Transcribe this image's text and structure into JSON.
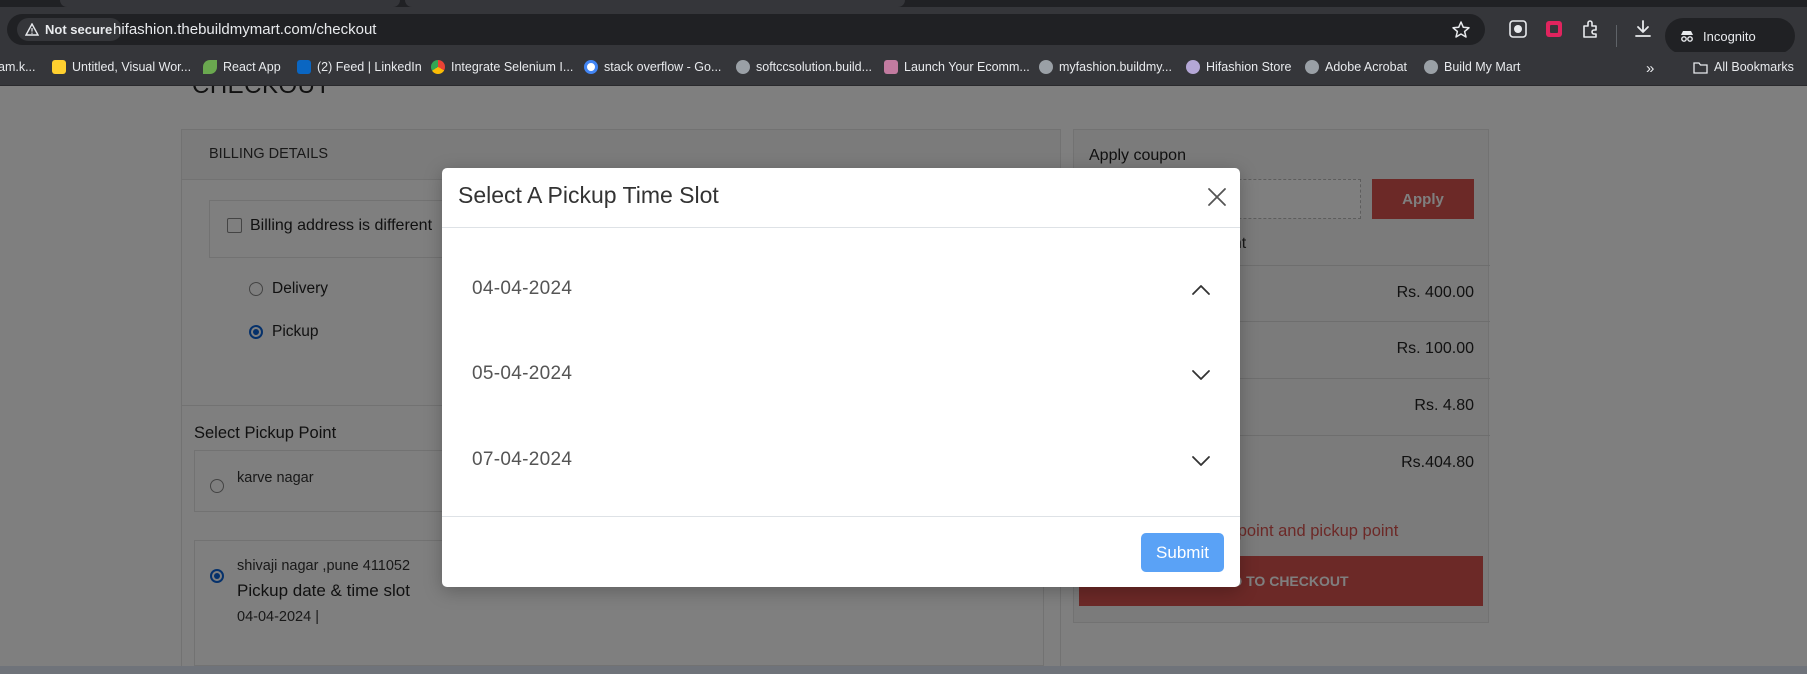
{
  "browser": {
    "not_secure_label": "Not secure",
    "url": "hifashion.thebuildmymart.com/checkout",
    "incognito_label": "Incognito",
    "all_bookmarks_label": "All Bookmarks",
    "bookmarks": [
      {
        "label": "am.k...",
        "icon": "favicon-partial"
      },
      {
        "label": "Untitled, Visual Wor...",
        "icon": "miro-icon"
      },
      {
        "label": "React App",
        "icon": "leaf-icon"
      },
      {
        "label": "(2) Feed | LinkedIn",
        "icon": "linkedin-icon"
      },
      {
        "label": "Integrate Selenium I...",
        "icon": "chrome-icon"
      },
      {
        "label": "stack overflow - Go...",
        "icon": "google-icon"
      },
      {
        "label": "softccsolution.build...",
        "icon": "globe-icon"
      },
      {
        "label": "Launch Your Ecomm...",
        "icon": "store-icon"
      },
      {
        "label": "myfashion.buildmy...",
        "icon": "globe-icon"
      },
      {
        "label": "Hifashion Store",
        "icon": "hifashion-icon"
      },
      {
        "label": "Adobe Acrobat",
        "icon": "globe-icon"
      },
      {
        "label": "Build My Mart",
        "icon": "globe-icon"
      }
    ]
  },
  "page": {
    "title": "CHECKOUT",
    "billing": {
      "header": "BILLING DETAILS",
      "different_address_label": "Billing address is different",
      "delivery_label": "Delivery",
      "pickup_label": "Pickup",
      "select_pickup_point_label": "Select Pickup Point",
      "pickup_points": [
        {
          "name": "karve nagar"
        },
        {
          "name": "shivaji nagar ,pune 411052",
          "slot_label": "Pickup date & time slot",
          "slot_value": "04-04-2024 |"
        }
      ]
    },
    "summary": {
      "apply_coupon_label": "Apply coupon",
      "apply_button": "Apply",
      "column_partial": "unt",
      "rows": [
        "Rs. 400.00",
        "Rs. 100.00",
        "Rs. 4.80",
        "Rs.404.80"
      ],
      "error_partial": "p point and pickup point",
      "checkout_partial": "EED TO CHECKOUT"
    }
  },
  "modal": {
    "title": "Select A Pickup Time Slot",
    "dates": [
      {
        "label": "04-04-2024",
        "expanded": true
      },
      {
        "label": "05-04-2024",
        "expanded": false
      },
      {
        "label": "07-04-2024",
        "expanded": false
      }
    ],
    "submit_label": "Submit"
  },
  "colors": {
    "accent_red": "#d9534f",
    "submit_blue": "#5aa2f6",
    "radio_blue": "#0b63d6"
  }
}
